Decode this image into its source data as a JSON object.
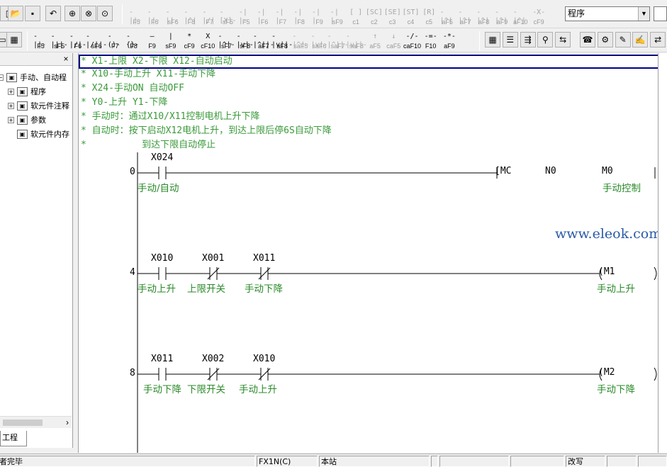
{
  "toolbar_top": {
    "file_buttons": [
      "new-file-icon",
      "open-folder-icon",
      "save-icon",
      "undo-icon",
      "zoom-icon",
      "search-icon",
      "monitor-icon"
    ],
    "ladder_buttons": [
      {
        "glyph": "-||-",
        "label": "F5"
      },
      {
        "glyph": "-||-",
        "label": "F6"
      },
      {
        "glyph": "-||-",
        "label": "sF6"
      },
      {
        "glyph": "-|^|",
        "label": "F8"
      },
      {
        "glyph": "-|/|",
        "label": "F7"
      },
      {
        "glyph": "-[X]-",
        "label": "sF5"
      },
      {
        "glyph": "-| |-",
        "label": "F5"
      },
      {
        "glyph": "-|  |",
        "label": "F6"
      },
      {
        "glyph": "-|  |",
        "label": "F7"
      },
      {
        "glyph": "-|  |",
        "label": "F8"
      },
      {
        "glyph": "-|  |",
        "label": "F9"
      },
      {
        "glyph": "-|  |",
        "label": "sF9"
      },
      {
        "glyph": "[ ]",
        "label": "c1"
      },
      {
        "glyph": "[SC]",
        "label": "c2"
      },
      {
        "glyph": "[SE]",
        "label": "c3"
      },
      {
        "glyph": "[ST]",
        "label": "c4"
      },
      {
        "glyph": "[R]",
        "label": "c5"
      },
      {
        "glyph": "-|^|",
        "label": "aF5"
      },
      {
        "glyph": "-|^|",
        "label": "aF7"
      },
      {
        "glyph": "-|^|",
        "label": "aF8"
      },
      {
        "glyph": "-|^|",
        "label": "aF9"
      },
      {
        "glyph": "-|^|",
        "label": "aF10"
      },
      {
        "glyph": "-X-",
        "label": "cF9"
      }
    ],
    "mode_select": {
      "value": "程序"
    }
  },
  "toolbar_second": {
    "left_icons": [
      "monitor-icon",
      "ladder-view-icon"
    ],
    "ladder_buttons": [
      {
        "glyph": "-||-",
        "label": "F5"
      },
      {
        "glyph": "-|||-",
        "label": "sF5"
      },
      {
        "glyph": "-|/|-",
        "label": "F6"
      },
      {
        "glyph": "-|/||-",
        "label": "sF6"
      },
      {
        "glyph": "-()-",
        "label": "F7"
      },
      {
        "glyph": "-{}-",
        "label": "F8"
      },
      {
        "glyph": "—",
        "label": "F9"
      },
      {
        "glyph": "|",
        "label": "sF9"
      },
      {
        "glyph": "*",
        "label": "cF9"
      },
      {
        "glyph": "X",
        "label": "cF10"
      },
      {
        "glyph": "-|^|-",
        "label": "sF7"
      },
      {
        "glyph": "-|v|-",
        "label": "sF8"
      },
      {
        "glyph": "-|^||-",
        "label": "aF7"
      },
      {
        "glyph": "-|v||-",
        "label": "aF8"
      },
      {
        "glyph": "-|^|-",
        "label": "saF5"
      },
      {
        "glyph": "-|v|-",
        "label": "saF6"
      },
      {
        "glyph": "-|^||-",
        "label": "saF7"
      },
      {
        "glyph": "-|v||-",
        "label": "saF8"
      },
      {
        "glyph": "↑",
        "label": "aF5"
      },
      {
        "glyph": "↓",
        "label": "caF5"
      },
      {
        "glyph": "-/-",
        "label": "caF10"
      },
      {
        "glyph": "-=-",
        "label": "F10"
      },
      {
        "glyph": "-*-",
        "label": "aF9"
      }
    ],
    "right_icons": [
      "device-comment-icon",
      "list-icon",
      "ladder-monitor-icon",
      "find-icon",
      "replace-icon",
      "telephone-icon",
      "setting-icon",
      "edit-icon",
      "write-icon",
      "network-icon"
    ]
  },
  "left_panel": {
    "tree": [
      {
        "label": "手动、自动程",
        "level": 0
      },
      {
        "label": "程序",
        "level": 1
      },
      {
        "label": "软元件注释",
        "level": 1
      },
      {
        "label": "参数",
        "level": 1
      },
      {
        "label": "软元件内存",
        "level": 1
      }
    ],
    "tab_label": "工程"
  },
  "comments": [
    "* X1-上限 X2-下限 X12-自动启动",
    "* X10-手动上升 X11-手动下降",
    "* X24-手动ON 自动OFF",
    "* Y0-上升 Y1-下降",
    "* 手动时：通过X10/X11控制电机上升下降",
    "* 自动时：按下启动X12电机上升，到达上限后停6S自动下降",
    "*          到达下限自动停止"
  ],
  "rungs": [
    {
      "step": "0",
      "contacts": [
        {
          "device": "X024",
          "type": "NO",
          "comment": "手动/自动"
        }
      ],
      "coil": {
        "instr": "[MC",
        "n": "N0",
        "device": "M0",
        "comment": "手动控制"
      }
    },
    {
      "step": "4",
      "contacts": [
        {
          "device": "X010",
          "type": "NO",
          "comment": "手动上升"
        },
        {
          "device": "X001",
          "type": "NC",
          "comment": "上限开关"
        },
        {
          "device": "X011",
          "type": "NC",
          "comment": "手动下降"
        }
      ],
      "coil": {
        "device": "(M1",
        "comment": "手动上升"
      }
    },
    {
      "step": "8",
      "contacts": [
        {
          "device": "X011",
          "type": "NO",
          "comment": "手动下降"
        },
        {
          "device": "X002",
          "type": "NC",
          "comment": "下限开关"
        },
        {
          "device": "X010",
          "type": "NC",
          "comment": "手动上升"
        }
      ],
      "coil": {
        "device": "(M2",
        "comment": "手动下降"
      }
    }
  ],
  "watermark": "www.eleok.com",
  "statusbar": {
    "message": "者完毕",
    "plc_type": "FX1N(C)",
    "station": "本站",
    "mode": "改写"
  }
}
